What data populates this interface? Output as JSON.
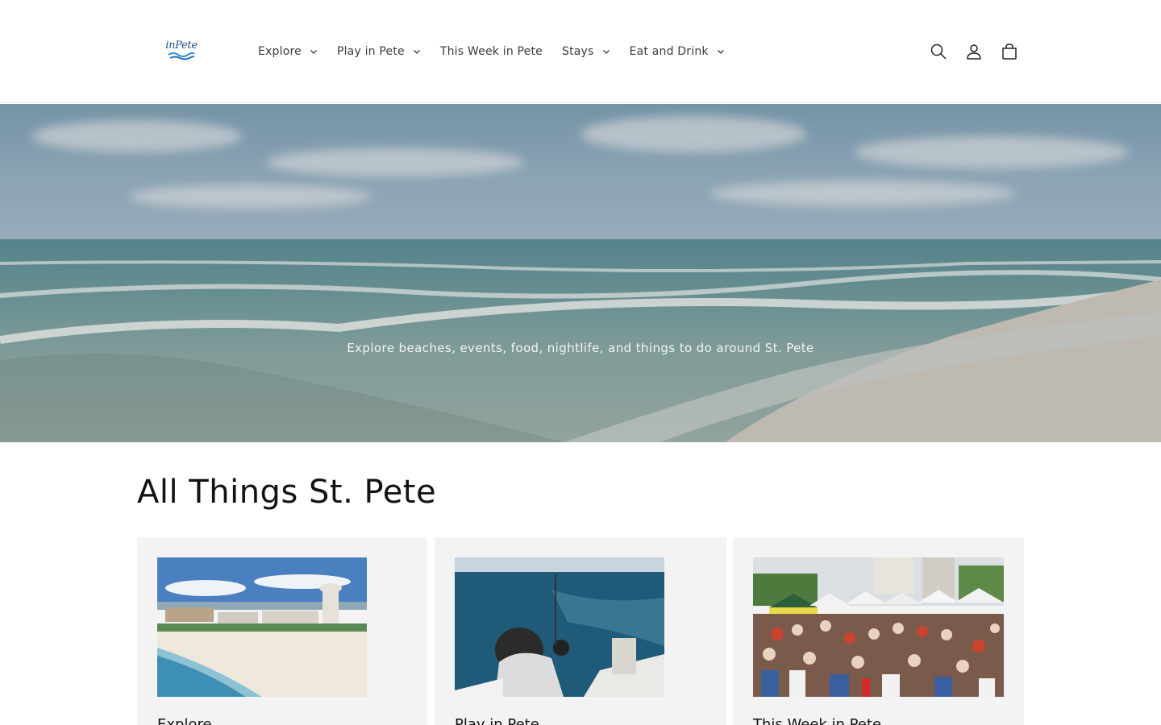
{
  "header": {
    "logo_text": "inPete",
    "nav": [
      {
        "label": "Explore",
        "has_dropdown": true
      },
      {
        "label": "Play in Pete",
        "has_dropdown": true
      },
      {
        "label": "This Week in Pete",
        "has_dropdown": false
      },
      {
        "label": "Stays",
        "has_dropdown": true
      },
      {
        "label": "Eat and Drink",
        "has_dropdown": true
      }
    ],
    "icons": [
      "search-icon",
      "account-icon",
      "cart-icon"
    ]
  },
  "hero": {
    "subtitle": "Explore beaches, events, food, nightlife, and things to do around St. Pete"
  },
  "collection": {
    "title": "All Things St. Pete",
    "cards": [
      {
        "title": "Explore",
        "image": "beach-resort-aerial"
      },
      {
        "title": "Play in Pete",
        "image": "boy-fishing-on-boat"
      },
      {
        "title": "This Week in Pete",
        "image": "outdoor-market-crowd"
      }
    ]
  },
  "colors": {
    "header_bg": "#ffffff",
    "card_bg": "#f3f3f3",
    "text": "#121212",
    "logo_blue": "#1f4e8c"
  }
}
